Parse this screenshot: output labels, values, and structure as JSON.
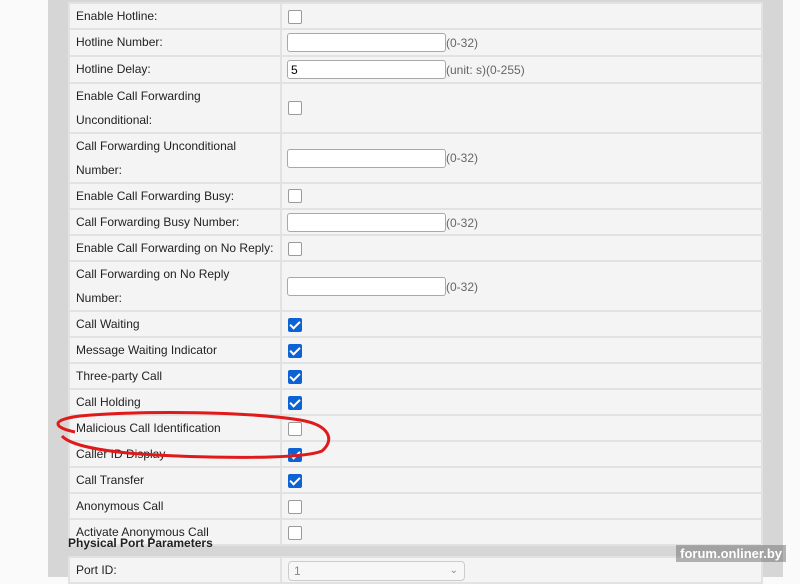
{
  "rows": [
    {
      "label": "Enable Hotline:",
      "type": "checkbox",
      "checked": false
    },
    {
      "label": "Hotline Number:",
      "type": "text",
      "value": "",
      "hint": "(0-32)"
    },
    {
      "label": "Hotline Delay:",
      "type": "text",
      "value": "5",
      "hint": "(unit: s)(0-255)"
    },
    {
      "label": "Enable Call Forwarding Unconditional:",
      "type": "checkbox",
      "checked": false,
      "tall": true
    },
    {
      "label": "Call Forwarding Unconditional Number:",
      "type": "text",
      "value": "",
      "hint": "(0-32)",
      "tall": true
    },
    {
      "label": "Enable Call Forwarding Busy:",
      "type": "checkbox",
      "checked": false
    },
    {
      "label": "Call Forwarding Busy Number:",
      "type": "text",
      "value": "",
      "hint": "(0-32)"
    },
    {
      "label": "Enable Call Forwarding on No Reply:",
      "type": "checkbox",
      "checked": false
    },
    {
      "label": "Call Forwarding on No Reply Number:",
      "type": "text",
      "value": "",
      "hint": "(0-32)",
      "tall": true
    },
    {
      "label": "Call Waiting",
      "type": "checkbox",
      "checked": true
    },
    {
      "label": "Message Waiting Indicator",
      "type": "checkbox",
      "checked": true
    },
    {
      "label": "Three-party Call",
      "type": "checkbox",
      "checked": true
    },
    {
      "label": "Call Holding",
      "type": "checkbox",
      "checked": true
    },
    {
      "label": "Malicious Call Identification",
      "type": "checkbox",
      "checked": false
    },
    {
      "label": "Caller ID Display",
      "type": "checkbox",
      "checked": true
    },
    {
      "label": "Call Transfer",
      "type": "checkbox",
      "checked": true
    },
    {
      "label": "Anonymous Call",
      "type": "checkbox",
      "checked": false
    },
    {
      "label": "Activate Anonymous Call",
      "type": "checkbox",
      "checked": false
    }
  ],
  "section": "Physical Port Parameters",
  "port": {
    "label": "Port ID:",
    "value": "1"
  },
  "watermark": "forum.onliner.by",
  "colors": {
    "annotation": "#e01a1a",
    "checkbox": "#0b63d6"
  }
}
